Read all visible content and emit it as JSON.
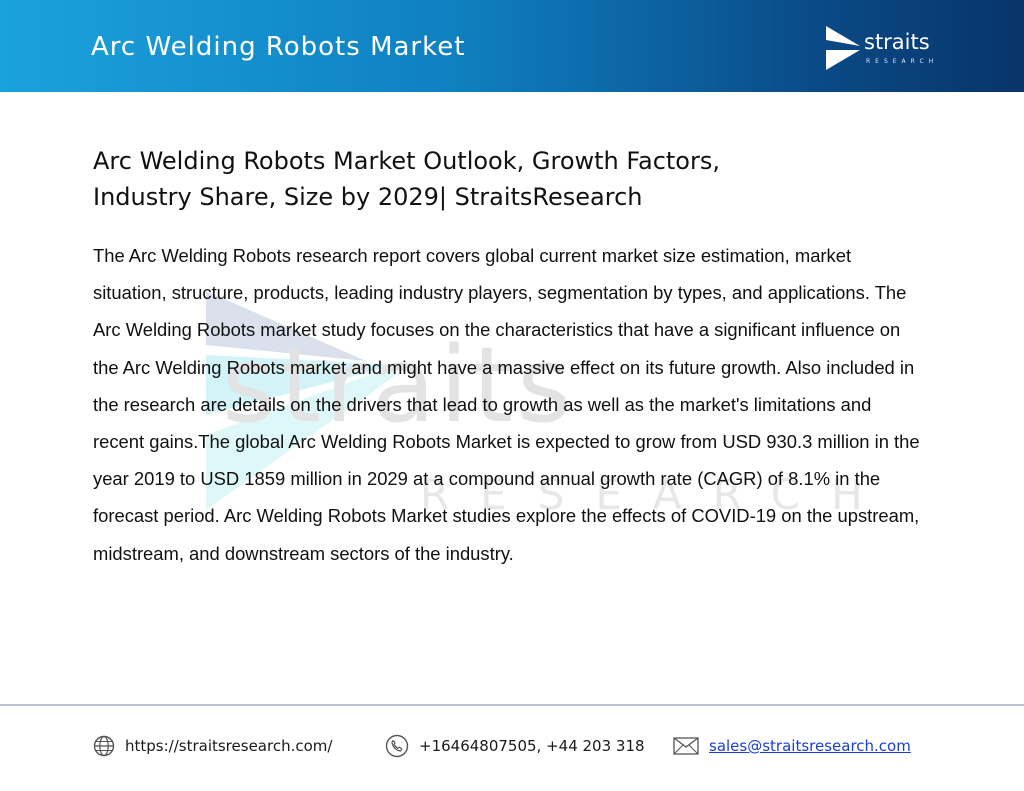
{
  "header": {
    "title": "Arc Welding Robots Market",
    "brand_name": "straits",
    "brand_sub": "RESEARCH",
    "colors": {
      "gradient_start": "#1aa2dc",
      "gradient_end": "#08346a"
    }
  },
  "watermark": {
    "word": "straits",
    "sub": "RESEARCH",
    "color": "#e3e3e3"
  },
  "article": {
    "headline": "Arc Welding Robots Market Outlook, Growth Factors, Industry Share, Size by 2029| StraitsResearch",
    "body": "The Arc Welding Robots research report covers global current market size estimation, market situation, structure, products, leading industry players, segmentation by types, and applications. The Arc Welding Robots market study focuses on the characteristics that have a significant influence on the Arc Welding Robots market and might have a massive effect on its future growth. Also included in the research are details on the drivers that lead to growth as well as the market's limitations and recent gains.The global Arc Welding Robots Market is expected to grow from USD 930.3 million in the year 2019 to USD 1859 million in 2029 at a compound annual growth rate (CAGR) of 8.1% in the forecast period. Arc Welding Robots Market studies explore the effects of COVID-19 on the upstream, midstream, and downstream sectors of the industry."
  },
  "footer": {
    "website": "https://straitsresearch.com/",
    "phone": "+16464807505, +44 203 318",
    "email": "sales@straitsresearch.com",
    "icons": [
      "globe-icon",
      "phone-icon",
      "mail-icon"
    ],
    "link_color": "#1a3fd1"
  }
}
